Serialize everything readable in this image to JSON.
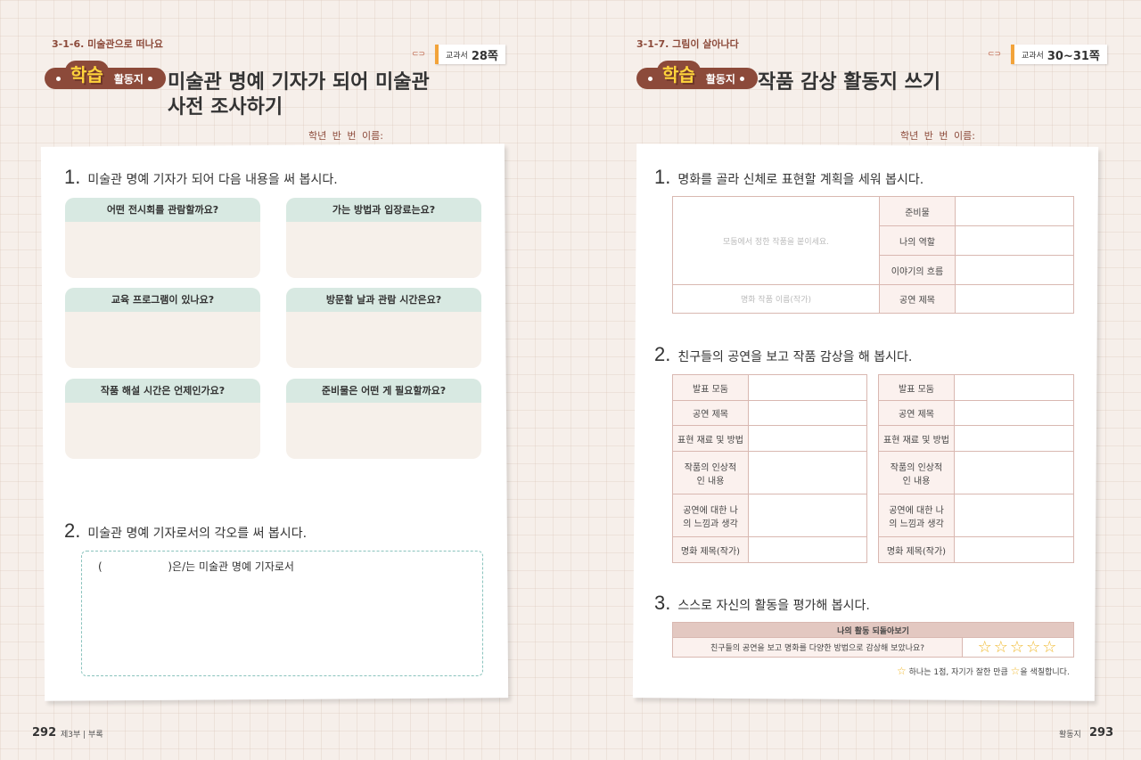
{
  "left": {
    "section": "3-1-6. 미술관으로 떠나요",
    "badge_big": "학습",
    "badge_small": "활동지",
    "title": "미술관 명예 기자가 되어 미술관 사전 조사하기",
    "textbook_label": "교과서",
    "textbook_page": "28쪽",
    "namebar": "학년 반 번 이름:",
    "q1": {
      "num": "1.",
      "text": "미술관 명예 기자가 되어 다음 내용을 써 봅시다."
    },
    "cards": [
      "어떤 전시회를 관람할까요?",
      "가는 방법과 입장료는요?",
      "교육 프로그램이 있나요?",
      "방문할 날과 관람 시간은요?",
      "작품 해설 시간은 언제인가요?",
      "준비물은 어떤 게 필요할까요?"
    ],
    "q2": {
      "num": "2.",
      "text": "미술관 명예 기자로서의 각오를 써 봅시다."
    },
    "q2_box_open": "(",
    "q2_box_rest": ")은/는 미술관 명예 기자로서",
    "footer_num": "292",
    "footer_text": "제3부 | 부록"
  },
  "right": {
    "section": "3-1-7. 그림이 살아나다",
    "badge_big": "학습",
    "badge_small": "활동지",
    "title": "작품 감상 활동지 쓰기",
    "textbook_label": "교과서",
    "textbook_page": "30~31쪽",
    "namebar": "학년 반 번 이름:",
    "q1": {
      "num": "1.",
      "text": "명화를 골라 신체로 표현할 계획을 세워 봅시다."
    },
    "t1": {
      "placeholder_image": "모둠에서 정한 작품을 붙이세요.",
      "placeholder_title": "명화 작품 이름(작가)",
      "rows": [
        "준비물",
        "나의 역할",
        "이야기의 흐름",
        "공연 제목"
      ]
    },
    "q2": {
      "num": "2.",
      "text": "친구들의 공연을 보고 작품 감상을 해 봅시다."
    },
    "t2_rows": [
      "발표 모둠",
      "공연 제목",
      "표현 재료 및 방법",
      "작품의 인상적인 내용",
      "공연에 대한 나의 느낌과 생각",
      "명화 제목(작가)"
    ],
    "q3": {
      "num": "3.",
      "text": "스스로 자신의 활동을 평가해 봅시다."
    },
    "t3": {
      "header": "나의 활동 되돌아보기",
      "question": "친구들의 공연을 보고 명화를 다양한 방법으로 감상해 보았나요?",
      "stars": "☆☆☆☆☆"
    },
    "note_a": "하나는 1점, 자기가 잘한 만큼",
    "note_b": "을 색칠합니다.",
    "footer_text": "활동지",
    "footer_num": "293"
  },
  "colors": {
    "accent": "#8c4a3a",
    "card_head": "#d8e9e2",
    "star": "#f0b92e"
  }
}
